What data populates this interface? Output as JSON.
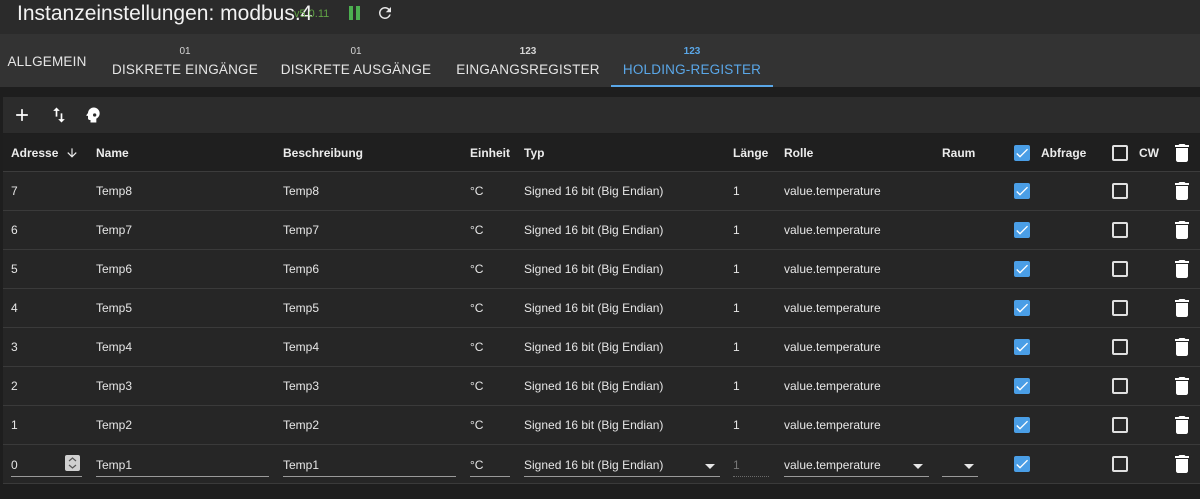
{
  "header": {
    "title": "Instanzeinstellungen: modbus.4",
    "version": "v5.0.11"
  },
  "tabs": [
    {
      "num": "",
      "label": "ALLGEMEIN"
    },
    {
      "num": "01",
      "label": "DISKRETE EINGÄNGE"
    },
    {
      "num": "01",
      "label": "DISKRETE AUSGÄNGE"
    },
    {
      "num": "123",
      "label": "EINGANGSREGISTER"
    },
    {
      "num": "123",
      "label": "HOLDING-REGISTER"
    }
  ],
  "active_tab": "HOLDING-REGISTER",
  "toolbar": {
    "icons": [
      "add-icon",
      "import-export-icon",
      "head-icon"
    ]
  },
  "table": {
    "columns": {
      "address": "Adresse",
      "name": "Name",
      "description": "Beschreibung",
      "unit": "Einheit",
      "type": "Typ",
      "length": "Länge",
      "role": "Rolle",
      "room": "Raum",
      "poll": "Abfrage",
      "cw": "CW"
    },
    "header_poll_checked": true,
    "header_cw_checked": false,
    "rows": [
      {
        "address": "7",
        "name": "Temp8",
        "description": "Temp8",
        "unit": "°C",
        "type": "Signed 16 bit (Big Endian)",
        "length": "1",
        "role": "value.temperature",
        "poll": true,
        "cw": false
      },
      {
        "address": "6",
        "name": "Temp7",
        "description": "Temp7",
        "unit": "°C",
        "type": "Signed 16 bit (Big Endian)",
        "length": "1",
        "role": "value.temperature",
        "poll": true,
        "cw": false
      },
      {
        "address": "5",
        "name": "Temp6",
        "description": "Temp6",
        "unit": "°C",
        "type": "Signed 16 bit (Big Endian)",
        "length": "1",
        "role": "value.temperature",
        "poll": true,
        "cw": false
      },
      {
        "address": "4",
        "name": "Temp5",
        "description": "Temp5",
        "unit": "°C",
        "type": "Signed 16 bit (Big Endian)",
        "length": "1",
        "role": "value.temperature",
        "poll": true,
        "cw": false
      },
      {
        "address": "3",
        "name": "Temp4",
        "description": "Temp4",
        "unit": "°C",
        "type": "Signed 16 bit (Big Endian)",
        "length": "1",
        "role": "value.temperature",
        "poll": true,
        "cw": false
      },
      {
        "address": "2",
        "name": "Temp3",
        "description": "Temp3",
        "unit": "°C",
        "type": "Signed 16 bit (Big Endian)",
        "length": "1",
        "role": "value.temperature",
        "poll": true,
        "cw": false
      },
      {
        "address": "1",
        "name": "Temp2",
        "description": "Temp2",
        "unit": "°C",
        "type": "Signed 16 bit (Big Endian)",
        "length": "1",
        "role": "value.temperature",
        "poll": true,
        "cw": false
      }
    ],
    "edit_row": {
      "address": "0",
      "name": "Temp1",
      "description": "Temp1",
      "unit": "°C",
      "type": "Signed 16 bit (Big Endian)",
      "length": "1",
      "role": "value.temperature",
      "room": "",
      "poll": true,
      "cw": false
    }
  },
  "colors": {
    "accent": "#5aa7e8",
    "checkbox": "#4a9ee6",
    "status_green": "#4caf50",
    "version_green": "#61a345"
  }
}
